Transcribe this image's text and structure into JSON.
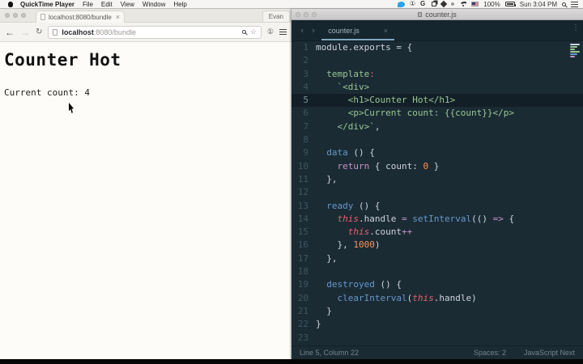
{
  "menu_bar": {
    "app_name": "QuickTime Player",
    "menus": [
      "File",
      "Edit",
      "View",
      "Window",
      "Help"
    ],
    "status_icons": [
      "twitter",
      "one-circle",
      "g",
      "windows",
      "dropbox",
      "dot",
      "wifi",
      "us-flag"
    ],
    "one_circle_glyph": "①",
    "g_glyph": "G",
    "battery_percent": "100%",
    "clock": "Sun 3:04 PM"
  },
  "browser": {
    "tab_title": "localhost:8080/bundle",
    "tab_close_glyph": "×",
    "profile_name": "Evan",
    "back_glyph": "←",
    "forward_glyph": "→",
    "reload_glyph": "↻",
    "url_host": "localhost",
    "url_rest": ":8080/bundle",
    "star_glyph": "☆",
    "ext_badge_glyph": "①",
    "page": {
      "heading": "Counter Hot",
      "count_line": "Current count: 4"
    }
  },
  "editor": {
    "window_title": "counter.js",
    "tab_title": "counter.js",
    "tab_close_glyph": "×",
    "back_chevron": "‹",
    "forward_chevron": "›",
    "overflow_glyph": "⋮",
    "active_line": 5,
    "status": {
      "position": "Line 5, Column 22",
      "indent": "Spaces: 2",
      "syntax": "JavaScript Next"
    },
    "minimap_line_colors": [
      "#cdd3de",
      "#99c794",
      "#99c794",
      "#99c794",
      "#6699cc",
      "#c594c5"
    ],
    "colors": {
      "background": "#1b2b34",
      "fg": "#cdd3de",
      "green": "#99c794",
      "blue": "#6699cc",
      "purple": "#c594c5",
      "red": "#ec5f67",
      "orange": "#f99157",
      "tab_underline": "#7fa8bd"
    },
    "lines": [
      {
        "n": 1,
        "tokens": [
          [
            "fg",
            "module.exports = {"
          ]
        ]
      },
      {
        "n": 2,
        "tokens": []
      },
      {
        "n": 3,
        "tokens": [
          [
            "fg",
            "  "
          ],
          [
            "green",
            "template"
          ],
          [
            "red",
            ":"
          ]
        ]
      },
      {
        "n": 4,
        "tokens": [
          [
            "fg",
            "    "
          ],
          [
            "green",
            "`<div>"
          ]
        ]
      },
      {
        "n": 5,
        "tokens": [
          [
            "green",
            "      <h1>Counter Hot</h1>"
          ]
        ]
      },
      {
        "n": 6,
        "tokens": [
          [
            "green",
            "      <p>Current count: {{count}}</p>"
          ]
        ]
      },
      {
        "n": 7,
        "tokens": [
          [
            "green",
            "    </div>`"
          ],
          [
            "fg",
            ","
          ]
        ]
      },
      {
        "n": 8,
        "tokens": []
      },
      {
        "n": 9,
        "tokens": [
          [
            "fg",
            "  "
          ],
          [
            "blue",
            "data"
          ],
          [
            "fg",
            " () {"
          ]
        ]
      },
      {
        "n": 10,
        "tokens": [
          [
            "fg",
            "    "
          ],
          [
            "purple",
            "return"
          ],
          [
            "fg",
            " { count: "
          ],
          [
            "orange",
            "0"
          ],
          [
            "fg",
            " }"
          ]
        ]
      },
      {
        "n": 11,
        "tokens": [
          [
            "fg",
            "  },"
          ]
        ]
      },
      {
        "n": 12,
        "tokens": []
      },
      {
        "n": 13,
        "tokens": [
          [
            "fg",
            "  "
          ],
          [
            "blue",
            "ready"
          ],
          [
            "fg",
            " () {"
          ]
        ]
      },
      {
        "n": 14,
        "tokens": [
          [
            "fg",
            "    "
          ],
          [
            "red",
            "this"
          ],
          [
            "fg",
            ".handle "
          ],
          [
            "purple",
            "="
          ],
          [
            "fg",
            " "
          ],
          [
            "blue",
            "setInterval"
          ],
          [
            "fg",
            "(() "
          ],
          [
            "purple",
            "=>"
          ],
          [
            "fg",
            " {"
          ]
        ]
      },
      {
        "n": 15,
        "tokens": [
          [
            "fg",
            "      "
          ],
          [
            "red",
            "this"
          ],
          [
            "fg",
            ".count"
          ],
          [
            "purple",
            "++"
          ]
        ]
      },
      {
        "n": 16,
        "tokens": [
          [
            "fg",
            "    }, "
          ],
          [
            "orange",
            "1000"
          ],
          [
            "fg",
            ")"
          ]
        ]
      },
      {
        "n": 17,
        "tokens": [
          [
            "fg",
            "  },"
          ]
        ]
      },
      {
        "n": 18,
        "tokens": []
      },
      {
        "n": 19,
        "tokens": [
          [
            "fg",
            "  "
          ],
          [
            "blue",
            "destroyed"
          ],
          [
            "fg",
            " () {"
          ]
        ]
      },
      {
        "n": 20,
        "tokens": [
          [
            "fg",
            "    "
          ],
          [
            "blue",
            "clearInterval"
          ],
          [
            "fg",
            "("
          ],
          [
            "red",
            "this"
          ],
          [
            "fg",
            ".handle)"
          ]
        ]
      },
      {
        "n": 21,
        "tokens": [
          [
            "fg",
            "  }"
          ]
        ]
      },
      {
        "n": 22,
        "tokens": [
          [
            "fg",
            "}"
          ]
        ]
      },
      {
        "n": 23,
        "tokens": []
      }
    ]
  }
}
